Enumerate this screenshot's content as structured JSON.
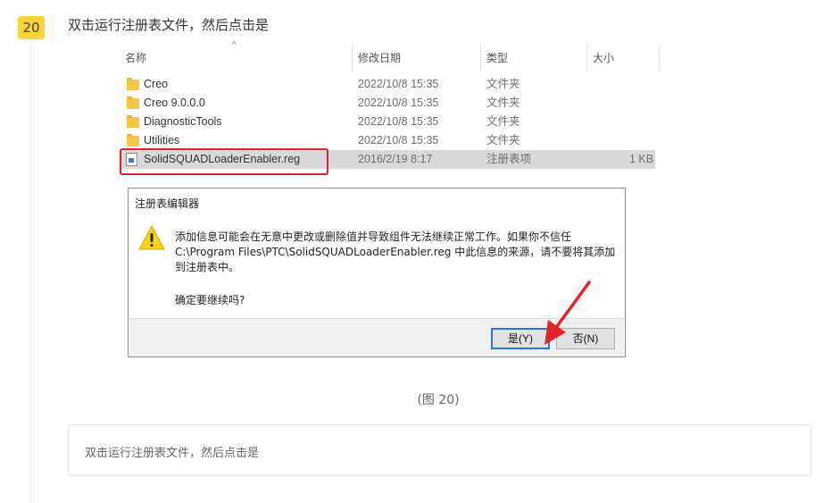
{
  "step": {
    "number": "20",
    "title": "双击运行注册表文件，然后点击是"
  },
  "explorer": {
    "sort_indicator": "^",
    "columns": {
      "name": "名称",
      "modified": "修改日期",
      "type": "类型",
      "size": "大小"
    },
    "files": [
      {
        "icon": "folder-icon",
        "name": "Creo",
        "modified": "2022/10/8 15:35",
        "type": "文件夹",
        "size": ""
      },
      {
        "icon": "folder-icon",
        "name": "Creo 9.0.0.0",
        "modified": "2022/10/8 15:35",
        "type": "文件夹",
        "size": ""
      },
      {
        "icon": "folder-icon",
        "name": "DiagnosticTools",
        "modified": "2022/10/8 15:35",
        "type": "文件夹",
        "size": ""
      },
      {
        "icon": "folder-icon",
        "name": "Utilities",
        "modified": "2022/10/8 15:35",
        "type": "文件夹",
        "size": ""
      },
      {
        "icon": "registry-file-icon",
        "name": "SolidSQUADLoaderEnabler.reg",
        "modified": "2016/2/19 8:17",
        "type": "注册表项",
        "size": "1 KB"
      }
    ]
  },
  "dialog": {
    "title": "注册表编辑器",
    "message": "添加信息可能会在无意中更改或删除值并导致组件无法继续正常工作。如果你不信任\nC:\\Program Files\\PTC\\SolidSQUADLoaderEnabler.reg 中此信息的来源，请不要将其添加\n到注册表中。",
    "confirm": "确定要继续吗?",
    "yes_label": "是(Y)",
    "no_label": "否(N)",
    "icon": "warning-icon"
  },
  "figure_caption": "(图 20)",
  "textbox": {
    "text": "双击运行注册表文件，然后点击是"
  },
  "colors": {
    "badge": "#fdd33a",
    "highlight": "#e3232a",
    "arrow": "#e3232a",
    "selection": "#d9d9d9",
    "default_button_border": "#2c74d9"
  }
}
